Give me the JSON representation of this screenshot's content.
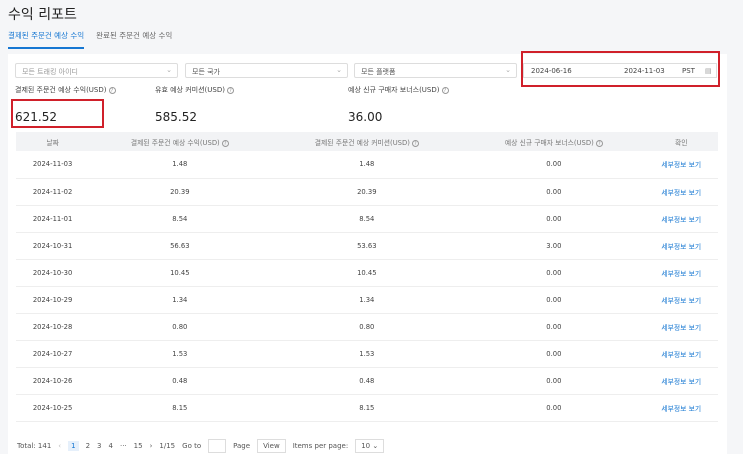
{
  "title": "수익 리포트",
  "tabs": [
    "결제된 주문건 예상 수익",
    "완료된 주문건 예상 수익"
  ],
  "filters": {
    "tracking": "모든 트래킹 아이디",
    "country": "모든 국가",
    "platform": "모든 플랫폼",
    "start_date": "2024-06-16",
    "end_date": "2024-11-03",
    "timezone": "PST"
  },
  "metrics": [
    {
      "label": "결제된 주문건 예상 수익(USD)",
      "value": "621.52"
    },
    {
      "label": "유효 예상 커미션(USD)",
      "value": "585.52"
    },
    {
      "label": "예상 신규 구매자 보너스(USD)",
      "value": "36.00"
    }
  ],
  "table": {
    "headers": [
      "날짜",
      "결제된 주문건 예상 수익(USD)",
      "결제된 주문건 예상 커미션(USD)",
      "예상 신규 구매자 보너스(USD)",
      "확인"
    ],
    "rows": [
      [
        "2024-11-03",
        "1.48",
        "1.48",
        "0.00",
        "세부정보 보기"
      ],
      [
        "2024-11-02",
        "20.39",
        "20.39",
        "0.00",
        "세부정보 보기"
      ],
      [
        "2024-11-01",
        "8.54",
        "8.54",
        "0.00",
        "세부정보 보기"
      ],
      [
        "2024-10-31",
        "56.63",
        "53.63",
        "3.00",
        "세부정보 보기"
      ],
      [
        "2024-10-30",
        "10.45",
        "10.45",
        "0.00",
        "세부정보 보기"
      ],
      [
        "2024-10-29",
        "1.34",
        "1.34",
        "0.00",
        "세부정보 보기"
      ],
      [
        "2024-10-28",
        "0.80",
        "0.80",
        "0.00",
        "세부정보 보기"
      ],
      [
        "2024-10-27",
        "1.53",
        "1.53",
        "0.00",
        "세부정보 보기"
      ],
      [
        "2024-10-26",
        "0.48",
        "0.48",
        "0.00",
        "세부정보 보기"
      ],
      [
        "2024-10-25",
        "8.15",
        "8.15",
        "0.00",
        "세부정보 보기"
      ]
    ]
  },
  "pager": {
    "total": "Total: 141",
    "pages": [
      "1",
      "2",
      "3",
      "4",
      "···",
      "15"
    ],
    "current": "1/15",
    "goto": "Go to",
    "page": "Page",
    "view": "View",
    "ipp": "Items per page:",
    "ipp_value": "10"
  }
}
